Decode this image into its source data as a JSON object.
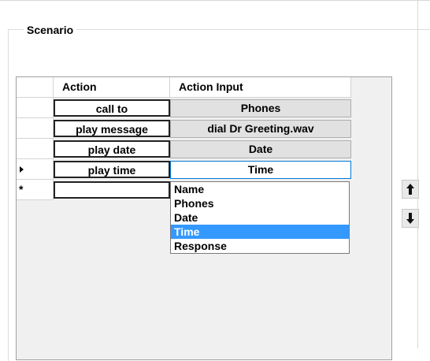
{
  "groupbox": {
    "title": "Scenario"
  },
  "grid": {
    "columns": [
      "Action",
      "Action Input"
    ],
    "rows": [
      {
        "action": "call to",
        "input": "Phones",
        "marker": ""
      },
      {
        "action": "play message",
        "input": "dial  Dr Greeting.wav",
        "marker": ""
      },
      {
        "action": "play date",
        "input": "Date",
        "marker": ""
      },
      {
        "action": "play time",
        "input": "Time",
        "marker": "current-row-arrow"
      },
      {
        "action": "",
        "input": "",
        "marker": "new-row-star"
      }
    ],
    "new_row_marker": "*"
  },
  "dropdown": {
    "options": [
      "Name",
      "Phones",
      "Date",
      "Time",
      "Response"
    ],
    "selected": "Time"
  },
  "side_buttons": [
    {
      "icon": "arrow-up-icon"
    },
    {
      "icon": "arrow-down-icon"
    }
  ]
}
